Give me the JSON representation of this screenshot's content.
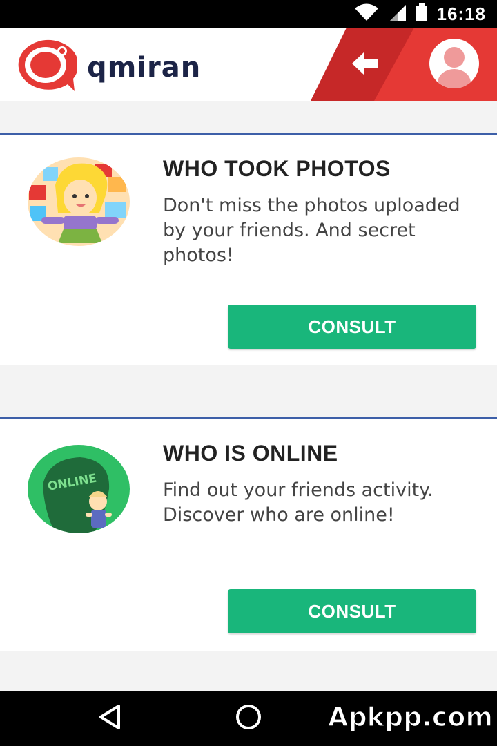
{
  "status_bar": {
    "time": "16:18",
    "icons": [
      "wifi-icon",
      "cell-signal-icon",
      "battery-icon"
    ]
  },
  "header": {
    "logo_text": "qmiran",
    "back_icon": "arrow-left-icon",
    "profile_icon": "profile-avatar-icon",
    "colors": {
      "brand_red": "#e53935",
      "brand_red_dark": "#c62828",
      "logo_text": "#1c2447"
    }
  },
  "cards": [
    {
      "title": "WHO TOOK PHOTOS",
      "description": "Don't miss the photos uploaded by your friends. And secret photos!",
      "button_label": "CONSULT",
      "image": "girl-with-photos-illustration"
    },
    {
      "title": "WHO IS ONLINE",
      "description": "Find out your friends activity. Discover who are online!",
      "button_label": "CONSULT",
      "image_label": "ONLINE",
      "image": "online-badge-illustration"
    }
  ],
  "colors": {
    "accent_green": "#19b67b",
    "divider_blue": "#3d5fa8",
    "page_bg": "#f3f3f3"
  },
  "nav_bar": {
    "icons": [
      "back-triangle-icon",
      "home-circle-icon"
    ]
  },
  "watermark": "Apkpp.com"
}
